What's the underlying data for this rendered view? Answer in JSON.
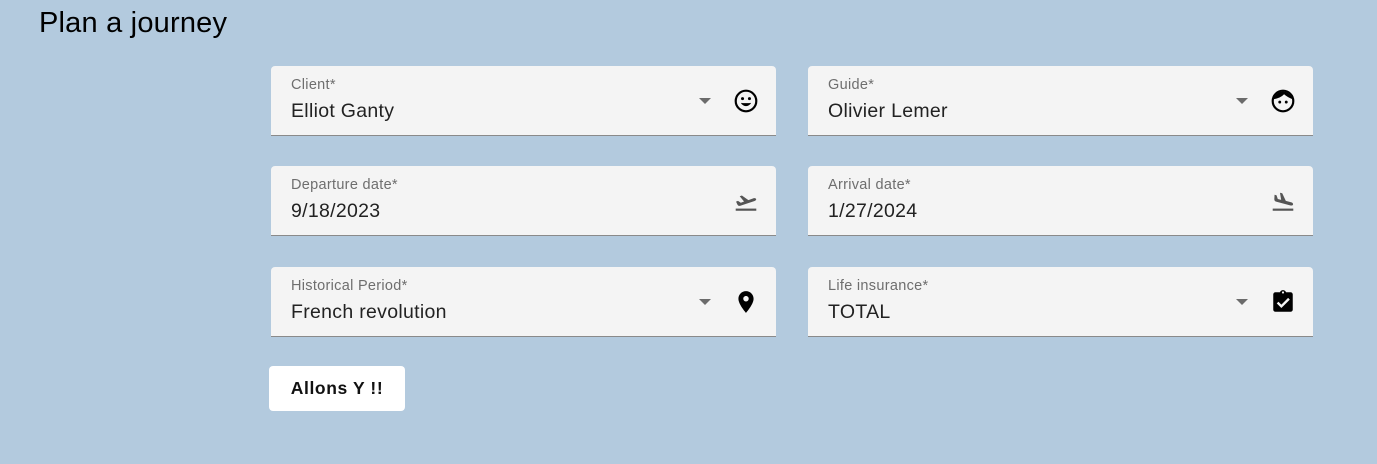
{
  "page": {
    "title": "Plan a journey"
  },
  "form": {
    "client": {
      "label": "Client*",
      "value": "Elliot Ganty",
      "icon": "smiley-face-icon"
    },
    "guide": {
      "label": "Guide*",
      "value": "Olivier Lemer",
      "icon": "face-icon"
    },
    "departure_date": {
      "label": "Departure date*",
      "value": "9/18/2023",
      "icon": "flight-takeoff-icon"
    },
    "arrival_date": {
      "label": "Arrival date*",
      "value": "1/27/2024",
      "icon": "flight-land-icon"
    },
    "historical_period": {
      "label": "Historical Period*",
      "value": "French revolution",
      "icon": "location-pin-icon"
    },
    "life_insurance": {
      "label": "Life insurance*",
      "value": "TOTAL",
      "icon": "assignment-check-icon"
    },
    "submit_label": "Allons Y !!"
  },
  "colors": {
    "background": "#b3cade",
    "field_background": "#f4f4f4",
    "button_background": "#ffffff"
  }
}
